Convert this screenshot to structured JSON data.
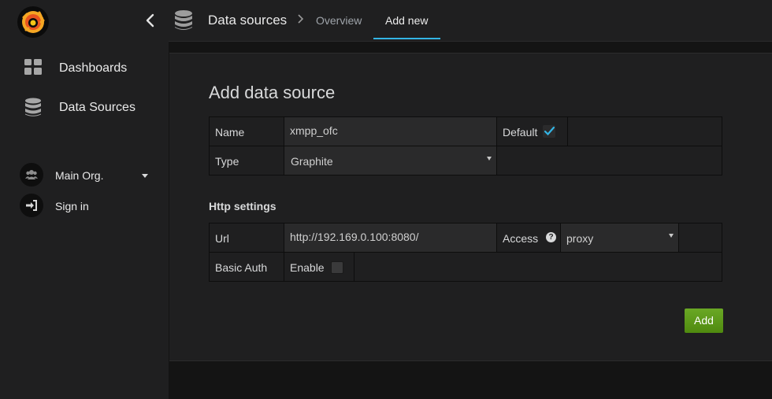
{
  "header": {
    "breadcrumb_title": "Data sources",
    "tabs": [
      {
        "label": "Overview"
      },
      {
        "label": "Add new"
      }
    ],
    "active_tab_color": "#33b5e5"
  },
  "sidebar": {
    "items": [
      {
        "label": "Dashboards",
        "icon": "grid-icon"
      },
      {
        "label": "Data Sources",
        "icon": "database-icon"
      }
    ],
    "org": {
      "label": "Main Org.",
      "icon": "users-icon"
    },
    "signin": {
      "label": "Sign in",
      "icon": "sign-in-icon"
    }
  },
  "form": {
    "title": "Add data source",
    "name_label": "Name",
    "name_value": "xmpp_ofc",
    "default_label": "Default",
    "default_checked": true,
    "type_label": "Type",
    "type_value": "Graphite",
    "http_heading": "Http settings",
    "url_label": "Url",
    "url_value": "http://192.169.0.100:8080/",
    "access_label": "Access",
    "access_value": "proxy",
    "basic_auth_label": "Basic Auth",
    "enable_label": "Enable",
    "enable_checked": false,
    "add_button": "Add",
    "add_button_color": "#5c9a17"
  }
}
